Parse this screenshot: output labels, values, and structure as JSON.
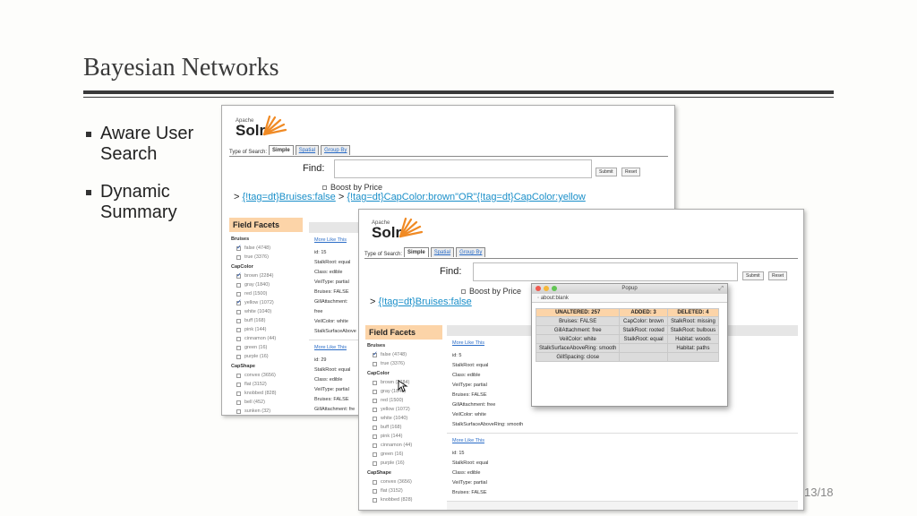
{
  "slide": {
    "title": "Bayesian Networks",
    "bullets": [
      "Aware User Search",
      "Dynamic Summary"
    ],
    "page_number": "13/18"
  },
  "solr": {
    "logo_small": "Apache",
    "logo_name": "Solr",
    "search_type_label": "Type of Search:",
    "tabs": [
      "Simple",
      "Spatial",
      "Group By"
    ],
    "find_label": "Find:",
    "submit_label": "Submit",
    "reset_label": "Reset",
    "boost_label": "Boost by Price",
    "field_facets_title": "Field Facets",
    "more_like_this": "More Like This"
  },
  "back_screen": {
    "filter_prefix": ">",
    "filter_1": "{!tag=dt}Bruises:false",
    "filter_sep": ">",
    "filter_2": "{!tag=dt}CapColor:brown\"OR\"{!tag=dt}CapColor:yellow",
    "facets": [
      {
        "group": "Bruises",
        "options": [
          {
            "label": "false (4748)",
            "checked": true
          },
          {
            "label": "true (3376)",
            "checked": false
          }
        ]
      },
      {
        "group": "CapColor",
        "options": [
          {
            "label": "brown (2284)",
            "checked": true
          },
          {
            "label": "gray (1840)",
            "checked": false
          },
          {
            "label": "red (1500)",
            "checked": false
          },
          {
            "label": "yellow (1072)",
            "checked": true
          },
          {
            "label": "white (1040)",
            "checked": false
          },
          {
            "label": "buff (168)",
            "checked": false
          },
          {
            "label": "pink (144)",
            "checked": false
          },
          {
            "label": "cinnamon (44)",
            "checked": false
          },
          {
            "label": "green (16)",
            "checked": false
          },
          {
            "label": "purple (16)",
            "checked": false
          }
        ]
      },
      {
        "group": "CapShape",
        "options": [
          {
            "label": "convex (3656)",
            "checked": false
          },
          {
            "label": "flat (3152)",
            "checked": false
          },
          {
            "label": "knobbed (828)",
            "checked": false
          },
          {
            "label": "bell (452)",
            "checked": false
          },
          {
            "label": "sunken (32)",
            "checked": false
          }
        ]
      }
    ],
    "results": [
      [
        "id: 15",
        "StalkRoot: equal",
        "Class: edible",
        "VeilType: partial",
        "Bruises: FALSE",
        "GillAttachment: free",
        "VeilColor: white",
        "StalkSurfaceAbove"
      ],
      [
        "id: 29",
        "StalkRoot: equal",
        "Class: edible",
        "VeilType: partial",
        "Bruises: FALSE",
        "GillAttachment: fre"
      ]
    ]
  },
  "front_screen": {
    "filter_prefix": ">",
    "filter_1": "{!tag=dt}Bruises:false",
    "facets": [
      {
        "group": "Bruises",
        "options": [
          {
            "label": "false (4748)",
            "checked": true
          },
          {
            "label": "true (3376)",
            "checked": false
          }
        ]
      },
      {
        "group": "CapColor",
        "options": [
          {
            "label": "brown (2284)",
            "checked": false
          },
          {
            "label": "gray (1840)",
            "checked": false
          },
          {
            "label": "red (1500)",
            "checked": false
          },
          {
            "label": "yellow (1072)",
            "checked": false
          },
          {
            "label": "white (1040)",
            "checked": false
          },
          {
            "label": "buff (168)",
            "checked": false
          },
          {
            "label": "pink (144)",
            "checked": false
          },
          {
            "label": "cinnamon (44)",
            "checked": false
          },
          {
            "label": "green (16)",
            "checked": false
          },
          {
            "label": "purple (16)",
            "checked": false
          }
        ]
      },
      {
        "group": "CapShape",
        "options": [
          {
            "label": "convex (3656)",
            "checked": false
          },
          {
            "label": "flat (3152)",
            "checked": false
          },
          {
            "label": "knobbed (828)",
            "checked": false
          }
        ]
      }
    ],
    "results": [
      [
        "id: 5",
        "StalkRoot: equal",
        "Class: edible",
        "VeilType: partial",
        "Bruises: FALSE",
        "GillAttachment: free",
        "VeilColor: white",
        "StalkSurfaceAboveRing: smooth"
      ],
      [
        "id: 15",
        "StalkRoot: equal",
        "Class: edible",
        "VeilType: partial",
        "Bruises: FALSE"
      ]
    ]
  },
  "popup": {
    "title": "Popup",
    "url": "about:blank",
    "headers": [
      "UNALTERED: 257",
      "ADDED: 3",
      "DELETED: 4"
    ],
    "rows": [
      [
        "Bruises: FALSE",
        "CapColor: brown",
        "StalkRoot: missing"
      ],
      [
        "GillAttachment: free",
        "StalkRoot: rooted",
        "StalkRoot: bulbous"
      ],
      [
        "VeilColor: white",
        "StalkRoot: equal",
        "Habitat: woods"
      ],
      [
        "StalkSurfaceAboveRing: smooth",
        "",
        "Habitat: paths"
      ],
      [
        "GillSpacing: close",
        "",
        ""
      ]
    ]
  }
}
